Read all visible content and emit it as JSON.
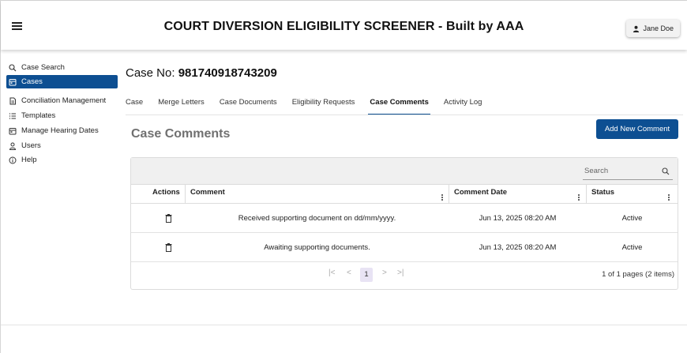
{
  "header": {
    "title": "COURT DIVERSION ELIGIBILITY SCREENER - Built by AAA",
    "user_name": "Jane Doe",
    "menu_icon": "hamburger-icon",
    "user_icon": "person-icon"
  },
  "sidebar": {
    "items": [
      {
        "label": "Case Search",
        "icon": "search-icon",
        "active": false
      },
      {
        "label": "Cases",
        "icon": "calendar-icon",
        "active": true
      },
      {
        "label": "Conciliation Management",
        "icon": "document-icon",
        "active": false
      },
      {
        "label": "Templates",
        "icon": "list-icon",
        "active": false
      },
      {
        "label": "Manage Hearing Dates",
        "icon": "calendar-icon",
        "active": false
      },
      {
        "label": "Users",
        "icon": "person-icon",
        "active": false
      },
      {
        "label": "Help",
        "icon": "info-icon",
        "active": false
      }
    ]
  },
  "case": {
    "label": "Case No:",
    "number": "981740918743209"
  },
  "tabs": [
    {
      "label": "Case",
      "active": false
    },
    {
      "label": "Merge Letters",
      "active": false
    },
    {
      "label": "Case Documents",
      "active": false
    },
    {
      "label": "Eligibility Requests",
      "active": false
    },
    {
      "label": "Case Comments",
      "active": true
    },
    {
      "label": "Activity Log",
      "active": false
    }
  ],
  "section": {
    "title": "Case Comments",
    "add_button": "Add New Comment"
  },
  "grid": {
    "search_placeholder": "Search",
    "columns": [
      "Actions",
      "Comment",
      "Comment Date",
      "Status"
    ],
    "rows": [
      {
        "comment": "Received supporting document on dd/mm/yyyy.",
        "date": "Jun 13, 2025 08:20 AM",
        "status": "Active"
      },
      {
        "comment": "Awaiting supporting documents.",
        "date": "Jun 13, 2025 08:20 AM",
        "status": "Active"
      }
    ],
    "pager": {
      "first": "|<",
      "prev": "<",
      "current_page": "1",
      "next": ">",
      "last": ">|",
      "info": "1 of 1 pages (2 items)"
    }
  },
  "colors": {
    "accent": "#0d4f92",
    "header_text": "#111111",
    "section_title": "#707070",
    "pager_current": "#e8e3f4"
  }
}
